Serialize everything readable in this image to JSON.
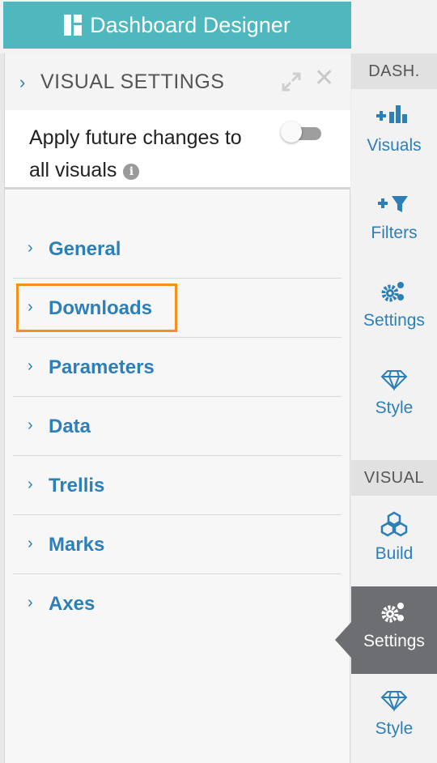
{
  "header": {
    "app_button": "Dashboard Designer"
  },
  "panel": {
    "title": "VISUAL SETTINGS",
    "apply_text_line1": "Apply future changes to",
    "apply_text_line2": "all visuals",
    "info_icon": "i",
    "close_glyph": "✕",
    "chevron": "›"
  },
  "sections": [
    {
      "label": "General"
    },
    {
      "label": "Downloads"
    },
    {
      "label": "Parameters"
    },
    {
      "label": "Data"
    },
    {
      "label": "Trellis"
    },
    {
      "label": "Marks"
    },
    {
      "label": "Axes"
    }
  ],
  "rail": {
    "dash_header": "DASH.",
    "visual_header": "VISUAL",
    "items": [
      {
        "label": "Visuals",
        "icon": "add-bar-chart-icon"
      },
      {
        "label": "Filters",
        "icon": "add-filter-icon"
      },
      {
        "label": "Settings",
        "icon": "gears-icon"
      },
      {
        "label": "Style",
        "icon": "diamond-icon"
      },
      {
        "label": "Build",
        "icon": "cubes-icon"
      },
      {
        "label": "Settings",
        "icon": "gears-icon"
      },
      {
        "label": "Style",
        "icon": "diamond-icon"
      }
    ],
    "active_item": "Settings (VISUAL)"
  },
  "colors": {
    "accent": "#2d7fb8",
    "header_bg": "#4fb8be",
    "highlight": "#f7901e",
    "active_bg": "#6d6e71"
  }
}
